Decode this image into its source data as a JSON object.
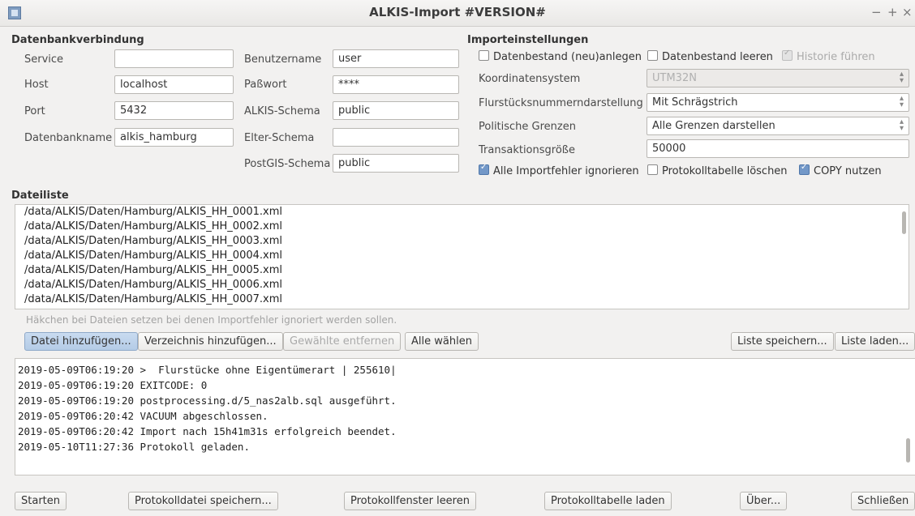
{
  "window": {
    "title": "ALKIS-Import #VERSION#",
    "controls": [
      "−",
      "+",
      "×"
    ]
  },
  "db": {
    "heading": "Datenbankverbindung",
    "service_label": "Service",
    "service_value": "",
    "host_label": "Host",
    "host_value": "localhost",
    "port_label": "Port",
    "port_value": "5432",
    "dbname_label": "Datenbankname",
    "dbname_value": "alkis_hamburg",
    "user_label": "Benutzername",
    "user_value": "user",
    "password_label": "Paßwort",
    "password_value": "****",
    "schema_label": "ALKIS-Schema",
    "schema_value": "public",
    "parent_schema_label": "Elter-Schema",
    "parent_schema_value": "",
    "postgis_schema_label": "PostGIS-Schema",
    "postgis_schema_value": "public"
  },
  "import": {
    "heading": "Importeinstellungen",
    "create_label": "Datenbestand (neu)anlegen",
    "create_checked": false,
    "clear_label": "Datenbestand leeren",
    "clear_checked": false,
    "history_label": "Historie führen",
    "history_checked": true,
    "crs_label": "Koordinatensystem",
    "crs_value": "UTM32N",
    "parcel_label": "Flurstücksnummerndarstellung",
    "parcel_value": "Mit Schrägstrich",
    "borders_label": "Politische Grenzen",
    "borders_value": "Alle Grenzen darstellen",
    "txsize_label": "Transaktionsgröße",
    "txsize_value": "50000",
    "ignore_errors_label": "Alle Importfehler ignorieren",
    "ignore_errors_checked": true,
    "drop_logtable_label": "Protokolltabelle löschen",
    "drop_logtable_checked": false,
    "copy_label": "COPY nutzen",
    "copy_checked": true
  },
  "files": {
    "heading": "Dateiliste",
    "items": [
      "/data/ALKIS/Daten/Hamburg/ALKIS_HH_0001.xml",
      "/data/ALKIS/Daten/Hamburg/ALKIS_HH_0002.xml",
      "/data/ALKIS/Daten/Hamburg/ALKIS_HH_0003.xml",
      "/data/ALKIS/Daten/Hamburg/ALKIS_HH_0004.xml",
      "/data/ALKIS/Daten/Hamburg/ALKIS_HH_0005.xml",
      "/data/ALKIS/Daten/Hamburg/ALKIS_HH_0006.xml",
      "/data/ALKIS/Daten/Hamburg/ALKIS_HH_0007.xml"
    ],
    "hint": "Häkchen bei Dateien setzen bei denen Importfehler ignoriert werden sollen.",
    "add_file": "Datei hinzufügen...",
    "add_dir": "Verzeichnis hinzufügen...",
    "remove_selected": "Gewählte entfernen",
    "select_all": "Alle wählen",
    "save_list": "Liste speichern...",
    "load_list": "Liste laden..."
  },
  "log": {
    "lines": [
      "2019-05-09T06:19:20 >  Flurstücke ohne Eigentümerart | 255610|",
      "2019-05-09T06:19:20 EXITCODE: 0",
      "2019-05-09T06:19:20 postprocessing.d/5_nas2alb.sql ausgeführt.",
      "2019-05-09T06:20:42 VACUUM abgeschlossen.",
      "2019-05-09T06:20:42 Import nach 15h41m31s erfolgreich beendet.",
      "2019-05-10T11:27:36 Protokoll geladen."
    ]
  },
  "footer": {
    "start": "Starten",
    "save_log": "Protokolldatei speichern...",
    "clear_log": "Protokollfenster leeren",
    "load_logtable": "Protokolltabelle laden",
    "about": "Über...",
    "close": "Schließen"
  }
}
